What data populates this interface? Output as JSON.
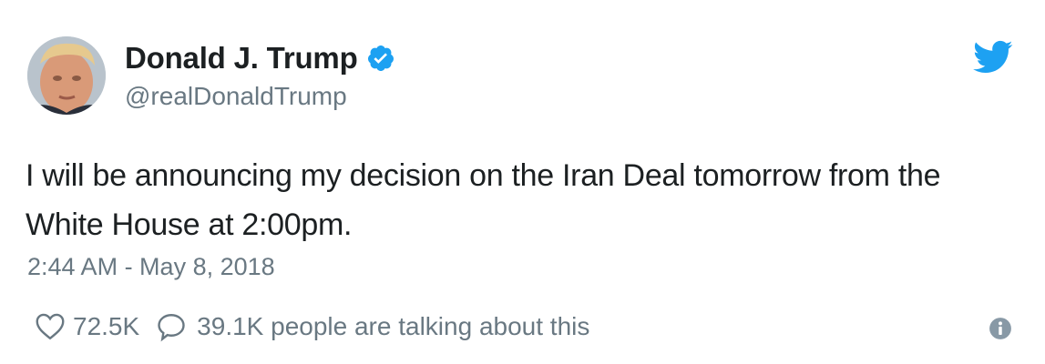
{
  "author": {
    "display_name": "Donald J. Trump",
    "handle": "@realDonaldTrump",
    "verified": true,
    "avatar_icon": "profile-photo"
  },
  "brand": {
    "icon": "twitter-bird-icon",
    "color": "#1da1f2"
  },
  "tweet": {
    "text": "I will be announcing my decision on the Iran Deal tomorrow from the White House at 2:00pm.",
    "timestamp": "2:44 AM - May 8, 2018"
  },
  "actions": {
    "likes": "72.5K",
    "replies": "39.1K people are talking about this",
    "like_icon": "heart-icon",
    "reply_icon": "speech-bubble-icon",
    "info_icon": "info-icon"
  },
  "colors": {
    "text": "#1c2022",
    "secondary": "#697882",
    "verified": "#1da1f2"
  }
}
